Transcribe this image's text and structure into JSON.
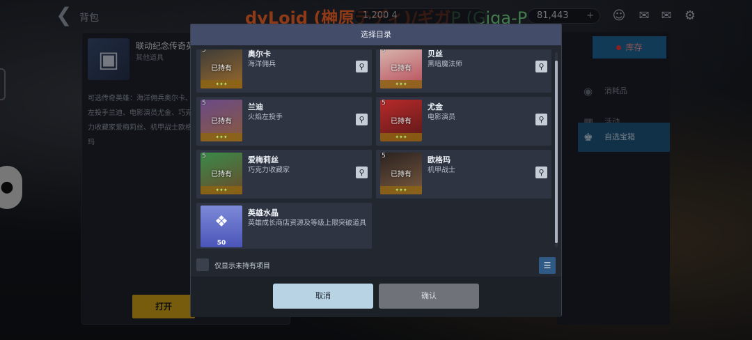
{
  "topbar": {
    "back_label": "背包",
    "overlay_text_orange": "dyLoid (榊原テディ)/ギガ",
    "overlay_text_green": "P (Giga-P",
    "currency_1": "1,200 4",
    "currency_2": "81,443",
    "plus": "+"
  },
  "left_panel": {
    "item_name": "联动纪念传奇英",
    "item_type": "其他道具",
    "description": "可选传奇英雄：海洋佣兵奥尔卡、左投手兰迪、电影演员尤金、巧克力收藏家爱梅莉丝、机甲战士欧格玛",
    "open_button": "打开"
  },
  "right_panel": {
    "storage_button": "库存",
    "categories": [
      {
        "label": "消耗品",
        "icon": "potion-icon"
      },
      {
        "label": "活动",
        "icon": "calendar-icon"
      },
      {
        "label": "自选宝箱",
        "icon": "crown-icon"
      }
    ]
  },
  "modal": {
    "title": "选择目录",
    "owned_label": "已持有",
    "stars": "✦✦✦",
    "cards": [
      {
        "star_level": "5",
        "name": "奥尔卡",
        "subtitle": "海洋佣兵",
        "owned": true,
        "colors": [
          "#3a3a3a",
          "#9a6a2a"
        ]
      },
      {
        "star_level": "5",
        "name": "贝丝",
        "subtitle": "黑暗魔法师",
        "owned": true,
        "colors": [
          "#d8b8b0",
          "#b84a58"
        ]
      },
      {
        "star_level": "5",
        "name": "兰迪",
        "subtitle": "火焰左投手",
        "owned": true,
        "colors": [
          "#6a4a88",
          "#8a5a3a"
        ]
      },
      {
        "star_level": "5",
        "name": "尤金",
        "subtitle": "电影演员",
        "owned": true,
        "colors": [
          "#b82a2a",
          "#5a1818"
        ]
      },
      {
        "star_level": "5",
        "name": "爱梅莉丝",
        "subtitle": "巧克力收藏家",
        "owned": true,
        "colors": [
          "#3a8a4a",
          "#6a4a2a"
        ]
      },
      {
        "star_level": "5",
        "name": "欧格玛",
        "subtitle": "机甲战士",
        "owned": true,
        "colors": [
          "#2a2220",
          "#7a5a40"
        ]
      }
    ],
    "crystal": {
      "name": "英雄水晶",
      "subtitle": "英雄成长商店资源及等级上限突破道具",
      "quantity": "50",
      "icon": "crystal-icon"
    },
    "filter_label": "仅显示未持有项目",
    "cancel": "取消",
    "confirm": "确认"
  }
}
